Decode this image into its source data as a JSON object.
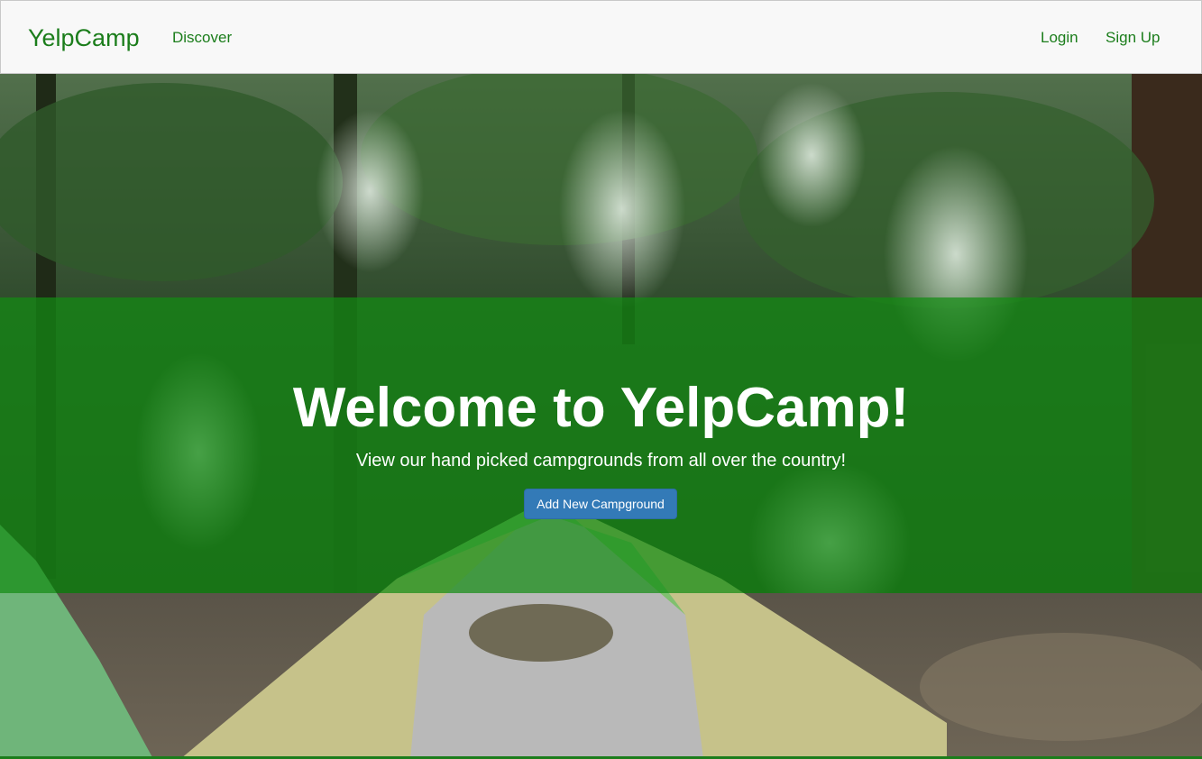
{
  "navbar": {
    "brand": "YelpCamp",
    "links": {
      "discover": "Discover",
      "login": "Login",
      "signup": "Sign Up"
    }
  },
  "hero": {
    "title": "Welcome to YelpCamp!",
    "subtitle": "View our hand picked campgrounds from all over the country!",
    "button_label": "Add New Campground"
  },
  "colors": {
    "brand_green": "#1b7d1b",
    "overlay_green": "#148c14",
    "button_blue": "#337ab7"
  }
}
